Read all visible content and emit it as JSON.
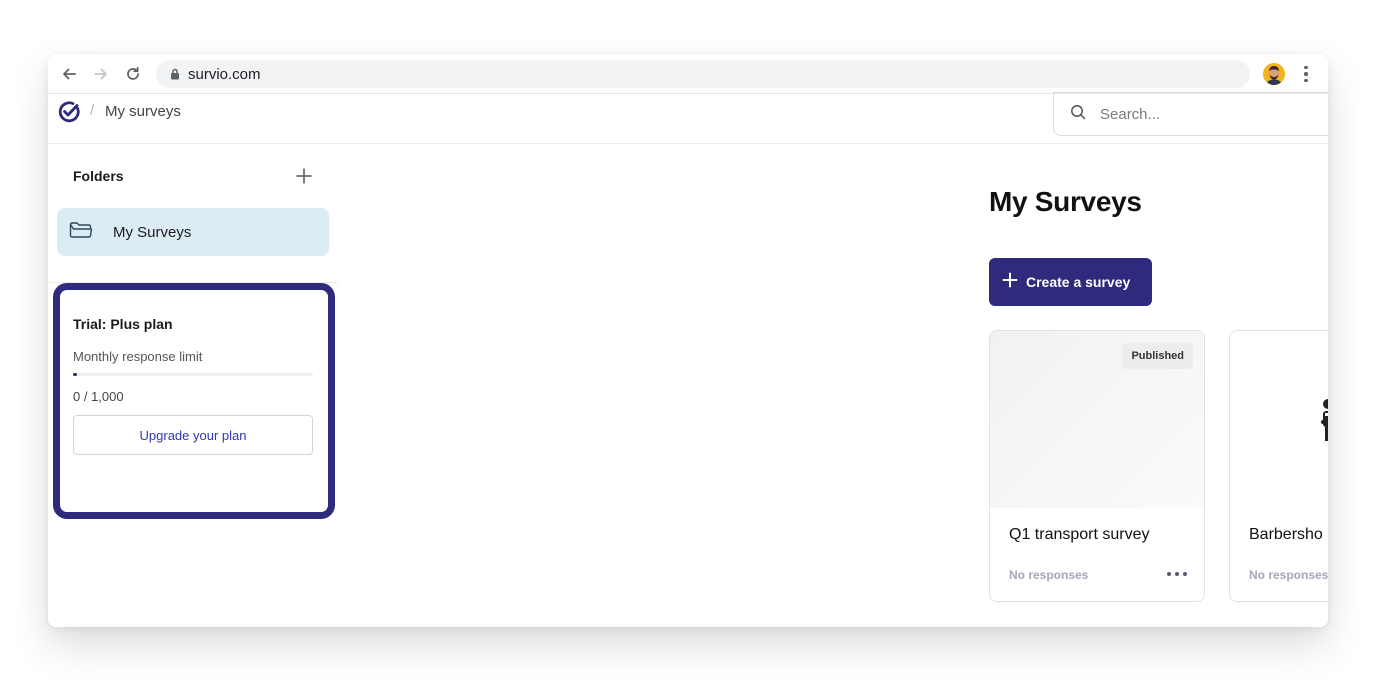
{
  "browser": {
    "url": "survio.com",
    "back_label": "back-arrow",
    "forward_label": "forward-arrow",
    "reload_label": "reload"
  },
  "header": {
    "breadcrumb_separator": "/",
    "breadcrumb": "My surveys",
    "search_placeholder": "Search..."
  },
  "sidebar": {
    "folders_title": "Folders",
    "folders": [
      {
        "label": "My Surveys",
        "selected": true
      }
    ]
  },
  "plan": {
    "title": "Trial: Plus plan",
    "limit_label": "Monthly response limit",
    "used": 0,
    "limit": 1000,
    "usage_text": "0 / 1,000",
    "usage_fraction": 0,
    "upgrade_label": "Upgrade your plan"
  },
  "main": {
    "title": "My Surveys",
    "create_label": "Create a survey",
    "surveys": [
      {
        "name": "Q1 transport survey",
        "status": "Published",
        "responses": "No responses"
      },
      {
        "name": "Barbersho",
        "status": "",
        "responses": "No responses"
      }
    ]
  },
  "colors": {
    "brand": "#2e2b7d",
    "folder_selected_bg": "#dbecf4",
    "link": "#2f37b5"
  },
  "icons": [
    "back-arrow-icon",
    "forward-arrow-icon",
    "reload-icon",
    "lock-icon",
    "user-avatar",
    "more-vertical-icon",
    "survio-logo",
    "search-icon",
    "plus-icon",
    "folder-icon",
    "more-horizontal-icon"
  ]
}
